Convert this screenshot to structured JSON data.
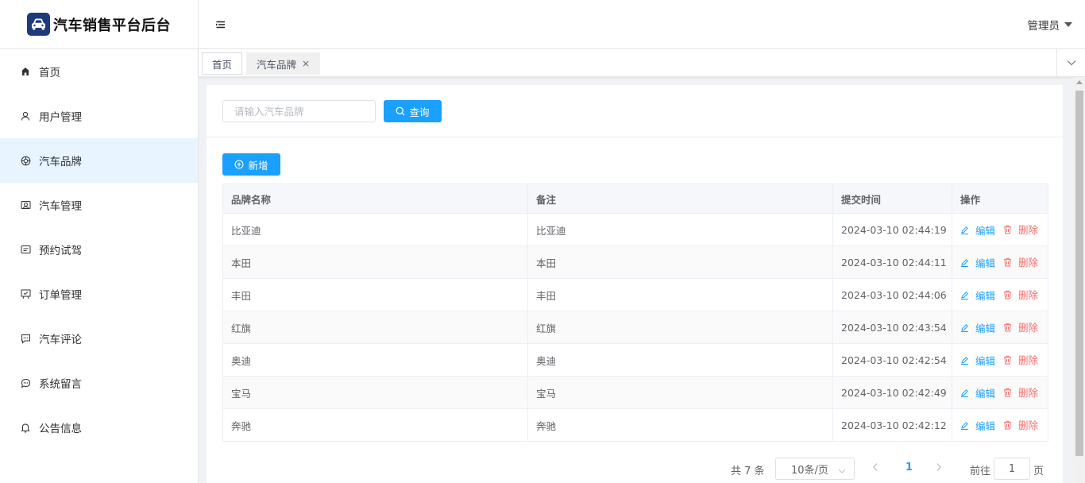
{
  "app": {
    "title": "汽车销售平台后台"
  },
  "sidebar": {
    "items": [
      {
        "label": "首页",
        "icon": "home-icon"
      },
      {
        "label": "用户管理",
        "icon": "user-icon"
      },
      {
        "label": "汽车品牌",
        "icon": "brand-icon"
      },
      {
        "label": "汽车管理",
        "icon": "car-manage-icon"
      },
      {
        "label": "预约试驾",
        "icon": "calendar-icon"
      },
      {
        "label": "订单管理",
        "icon": "order-icon"
      },
      {
        "label": "汽车评论",
        "icon": "comment-icon"
      },
      {
        "label": "系统留言",
        "icon": "message-icon"
      },
      {
        "label": "公告信息",
        "icon": "bell-icon"
      }
    ],
    "active_index": 2
  },
  "header": {
    "user_label": "管理员"
  },
  "tabs": [
    {
      "label": "首页"
    },
    {
      "label": "汽车品牌",
      "close": "×"
    }
  ],
  "search": {
    "placeholder": "请输入汽车品牌",
    "value": "",
    "button_label": "查询"
  },
  "toolbar": {
    "add_label": "新增"
  },
  "table": {
    "columns": [
      "品牌名称",
      "备注",
      "提交时间",
      "操作"
    ],
    "edit_label": "编辑",
    "delete_label": "删除",
    "rows": [
      {
        "name": "比亚迪",
        "note": "比亚迪",
        "time": "2024-03-10 02:44:19"
      },
      {
        "name": "本田",
        "note": "本田",
        "time": "2024-03-10 02:44:11"
      },
      {
        "name": "丰田",
        "note": "丰田",
        "time": "2024-03-10 02:44:06"
      },
      {
        "name": "红旗",
        "note": "红旗",
        "time": "2024-03-10 02:43:54"
      },
      {
        "name": "奥迪",
        "note": "奥迪",
        "time": "2024-03-10 02:42:54"
      },
      {
        "name": "宝马",
        "note": "宝马",
        "time": "2024-03-10 02:42:49"
      },
      {
        "name": "奔驰",
        "note": "奔驰",
        "time": "2024-03-10 02:42:12"
      }
    ]
  },
  "pagination": {
    "total_text": "共 7 条",
    "page_size_label": "10条/页",
    "current_page": "1",
    "goto_label": "前往",
    "goto_value": "1",
    "page_unit": "页"
  },
  "colors": {
    "primary": "#1aa0ff",
    "danger": "#f56c6c",
    "active_menu_bg": "#e8f4ff",
    "logo_bg": "#1f3a7a"
  }
}
